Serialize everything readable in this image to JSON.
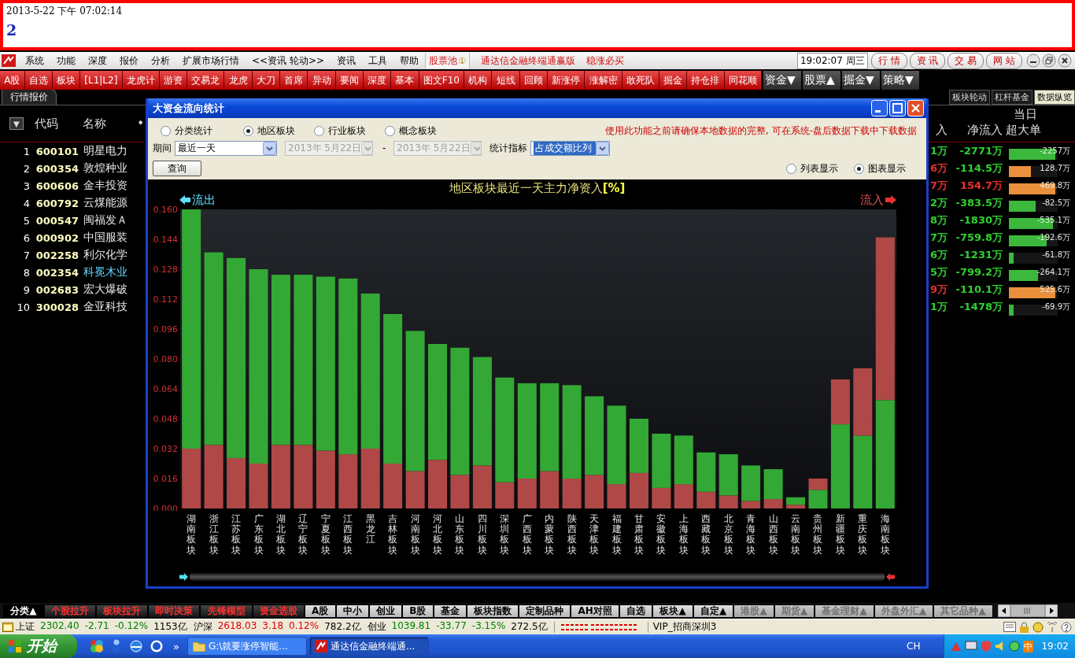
{
  "banner": {
    "datetime": "2013-5-22 下午 07:02:14",
    "counter": "2"
  },
  "menu_bar": {
    "items": [
      "系统",
      "功能",
      "深度",
      "报价",
      "分析",
      "扩展市场行情",
      "<<资讯 轮动>>",
      "资讯",
      "工具",
      "帮助"
    ],
    "stock_pool": {
      "label": "股票池",
      "badge": "①"
    },
    "slogans": [
      "通达信金融终端通赢版",
      "稳涨必买"
    ],
    "clock": "19:02:07 周三",
    "nav_buttons": [
      "行 情",
      "资 讯",
      "交 易",
      "网 站"
    ]
  },
  "toolbar": {
    "buttons": [
      "A股",
      "自选",
      "板块",
      "[L1|L2]",
      "龙虎计",
      "游资",
      "交易龙",
      "龙虎",
      "大刀",
      "首席",
      "异动",
      "要闻",
      "深度",
      "基本",
      "图文F10",
      "机构",
      "短线",
      "回顾",
      "新涨停",
      "涨解密",
      "敢死队",
      "掘金",
      "持仓排",
      "同花顺"
    ],
    "dropdowns": [
      "资金▼",
      "股票▲",
      "掘金▼",
      "策略▼"
    ]
  },
  "panel_tabs": [
    {
      "label": "行情报价",
      "selected": true
    }
  ],
  "side_tabs": [
    {
      "label": "板块轮动",
      "selected": false
    },
    {
      "label": "杠杆基金",
      "selected": false
    },
    {
      "label": "数据纵览",
      "selected": true
    }
  ],
  "stock_table": {
    "sort_button": "▼",
    "columns": [
      "代码",
      "名称",
      "•"
    ],
    "rows": [
      {
        "index": "1",
        "code": "600101",
        "name": "明星电力",
        "flagged": false
      },
      {
        "index": "2",
        "code": "600354",
        "name": "敦煌种业",
        "flagged": false
      },
      {
        "index": "3",
        "code": "600606",
        "name": "金丰投资",
        "flagged": false
      },
      {
        "index": "4",
        "code": "600792",
        "name": "云煤能源",
        "flagged": false
      },
      {
        "index": "5",
        "code": "000547",
        "name": "闽福发Ａ",
        "flagged": false
      },
      {
        "index": "6",
        "code": "000902",
        "name": "中国服装",
        "flagged": false
      },
      {
        "index": "7",
        "code": "002258",
        "name": "利尔化学",
        "flagged": false
      },
      {
        "index": "8",
        "code": "002354",
        "name": "科冕木业",
        "flagged": true
      },
      {
        "index": "9",
        "code": "002683",
        "name": "宏大爆破",
        "flagged": false
      },
      {
        "index": "10",
        "code": "300028",
        "name": "金亚科技",
        "flagged": false
      }
    ]
  },
  "flow_table": {
    "group_header": "当日",
    "columns": [
      "入",
      "净流入",
      "超大单"
    ],
    "rows": [
      {
        "column_1": "1万",
        "column_1_rising": false,
        "net_inflow": "-2771万",
        "net_rising": false,
        "super_large": {
          "text": "-2257万",
          "level": 0.95,
          "color": "#3cb83c"
        }
      },
      {
        "column_1": "6万",
        "column_1_rising": true,
        "net_inflow": "-114.5万",
        "net_rising": false,
        "super_large": {
          "text": "128.7万",
          "level": 0.45,
          "color": "#e8903c"
        }
      },
      {
        "column_1": "7万",
        "column_1_rising": true,
        "net_inflow": "154.7万",
        "net_rising": true,
        "super_large": {
          "text": "469.8万",
          "level": 0.95,
          "color": "#e8903c"
        }
      },
      {
        "column_1": "2万",
        "column_1_rising": false,
        "net_inflow": "-383.5万",
        "net_rising": false,
        "super_large": {
          "text": "-82.5万",
          "level": 0.55,
          "color": "#3cb83c"
        }
      },
      {
        "column_1": "8万",
        "column_1_rising": false,
        "net_inflow": "-1830万",
        "net_rising": false,
        "super_large": {
          "text": "-535.1万",
          "level": 0.9,
          "color": "#3cb83c"
        }
      },
      {
        "column_1": "7万",
        "column_1_rising": false,
        "net_inflow": "-759.8万",
        "net_rising": false,
        "super_large": {
          "text": "-192.6万",
          "level": 0.78,
          "color": "#3cb83c"
        }
      },
      {
        "column_1": "6万",
        "column_1_rising": false,
        "net_inflow": "-1231万",
        "net_rising": false,
        "super_large": {
          "text": "-61.8万",
          "level": 0.1,
          "color": "#3cb83c"
        }
      },
      {
        "column_1": "5万",
        "column_1_rising": false,
        "net_inflow": "-799.2万",
        "net_rising": false,
        "super_large": {
          "text": "-264.1万",
          "level": 0.6,
          "color": "#3cb83c"
        }
      },
      {
        "column_1": "9万",
        "column_1_rising": true,
        "net_inflow": "-110.1万",
        "net_rising": false,
        "super_large": {
          "text": "525.6万",
          "level": 0.95,
          "color": "#e8903c"
        }
      },
      {
        "column_1": "1万",
        "column_1_rising": false,
        "net_inflow": "-1478万",
        "net_rising": false,
        "super_large": {
          "text": "-69.9万",
          "level": 0.1,
          "color": "#3cb83c"
        }
      }
    ]
  },
  "dialog": {
    "title": "大资金流向统计",
    "scopes": [
      {
        "label": "分类统计",
        "selected": false
      },
      {
        "label": "地区板块",
        "selected": true
      },
      {
        "label": "行业板块",
        "selected": false
      },
      {
        "label": "概念板块",
        "selected": false
      }
    ],
    "notice": "使用此功能之前请确保本地数据的完整, 可在系统-盘后数据下载中下载数据",
    "period": {
      "label": "期间",
      "value": "最近一天"
    },
    "date_from": {
      "value": "2013年 5月22日",
      "disabled": true
    },
    "date_separator": "-",
    "date_to": {
      "value": "2013年 5月22日",
      "disabled": true
    },
    "metric": {
      "label": "统计指标",
      "value": "占成交额比列"
    },
    "query_button": "查询",
    "views": [
      {
        "label": "列表显示",
        "selected": false
      },
      {
        "label": "图表显示",
        "selected": true
      }
    ],
    "chart": {
      "chart_data": {
        "type": "bar",
        "title": "地区板块最近一天主力净资入**[%]**",
        "stacked": true,
        "categories": [
          "湖南板块",
          "浙江板块",
          "江苏板块",
          "广东板块",
          "湖北板块",
          "辽宁板块",
          "宁夏板块",
          "江西板块",
          "黑龙江",
          "吉林板块",
          "河南板块",
          "河北板块",
          "山东板块",
          "四川板块",
          "深圳板块",
          "广西板块",
          "内蒙板块",
          "陕西板块",
          "天津板块",
          "福建板块",
          "甘肃板块",
          "安徽板块",
          "上海板块",
          "西藏板块",
          "北京板块",
          "青海板块",
          "山西板块",
          "云南板块",
          "贵州板块",
          "新疆板块",
          "重庆板块",
          "海南板块"
        ],
        "series": [
          {
            "color": "#b04848",
            "values": [
              0.032,
              0.034,
              0.027,
              0.024,
              0.034,
              0.034,
              0.031,
              0.029,
              0.032,
              0.024,
              0.02,
              0.026,
              0.018,
              0.023,
              0.014,
              0.016,
              0.02,
              0.016,
              0.018,
              0.013,
              0.019,
              0.011,
              0.013,
              0.009,
              0.007,
              0.004,
              0.005,
              0.002,
              null,
              null,
              null,
              null
            ]
          },
          {
            "name": "流出",
            "color": "#34a834",
            "values": [
              0.128,
              0.103,
              0.107,
              0.104,
              0.091,
              0.091,
              0.093,
              0.094,
              0.083,
              0.08,
              0.075,
              0.062,
              0.068,
              0.058,
              0.056,
              0.051,
              0.047,
              0.05,
              0.042,
              0.042,
              0.029,
              0.029,
              0.026,
              0.021,
              0.022,
              0.019,
              0.016,
              0.004,
              0.01,
              0.045,
              0.039,
              0.058
            ]
          },
          {
            "name": "流入",
            "color": "#b04848",
            "values": [
              null,
              null,
              null,
              null,
              null,
              null,
              null,
              null,
              null,
              null,
              null,
              null,
              null,
              null,
              null,
              null,
              null,
              null,
              null,
              null,
              null,
              null,
              null,
              null,
              null,
              null,
              null,
              null,
              0.006,
              0.024,
              0.036,
              0.087
            ]
          }
        ],
        "ylim": [
          0,
          0.16
        ],
        "yticks": [
          {
            "value": 0,
            "label": "0.000"
          },
          {
            "value": 0.016,
            "label": "0.016"
          },
          {
            "value": 0.032,
            "label": "0.032"
          },
          {
            "value": 0.048,
            "label": "0.048"
          },
          {
            "value": 0.064,
            "label": "0.064"
          },
          {
            "value": 0.08,
            "label": "0.080"
          },
          {
            "value": 0.096,
            "label": "0.096"
          },
          {
            "value": 0.112,
            "label": "0.112"
          },
          {
            "value": 0.128,
            "label": "0.128"
          },
          {
            "value": 0.144,
            "label": "0.144"
          },
          {
            "value": 0.16,
            "label": "0.160"
          }
        ]
      }
    }
  },
  "category_tabs": [
    {
      "label": "分类▲",
      "kind": "menu",
      "selected": true
    },
    {
      "label": "个股拉升",
      "kind": "feature",
      "selected": false
    },
    {
      "label": "板块拉升",
      "kind": "feature",
      "selected": false
    },
    {
      "label": "即时决策",
      "kind": "feature",
      "selected": false
    },
    {
      "label": "先锋模型",
      "kind": "feature",
      "selected": false
    },
    {
      "label": "资金选股",
      "kind": "feature",
      "selected": false
    },
    {
      "label": "A股",
      "kind": "market",
      "selected": false
    },
    {
      "label": "中小",
      "kind": "market",
      "selected": false
    },
    {
      "label": "创业",
      "kind": "market",
      "selected": false
    },
    {
      "label": "B股",
      "kind": "market",
      "selected": false
    },
    {
      "label": "基金",
      "kind": "market",
      "selected": false
    },
    {
      "label": "板块指数",
      "kind": "market",
      "selected": false
    },
    {
      "label": "定制品种",
      "kind": "market",
      "selected": false
    },
    {
      "label": "AH对照",
      "kind": "market",
      "selected": false
    },
    {
      "label": "自选",
      "kind": "market",
      "selected": false
    },
    {
      "label": "板块▲",
      "kind": "market",
      "selected": false
    },
    {
      "label": "自定▲",
      "kind": "market",
      "selected": false
    },
    {
      "label": "港股▲",
      "kind": "dim",
      "selected": false
    },
    {
      "label": "期货▲",
      "kind": "dim",
      "selected": false
    },
    {
      "label": "基金理财▲",
      "kind": "dim",
      "selected": false
    },
    {
      "label": "外盘外汇▲",
      "kind": "dim",
      "selected": false
    },
    {
      "label": "其它品种▲",
      "kind": "dim",
      "selected": false
    }
  ],
  "status_bar": {
    "indices": [
      {
        "name": "上证",
        "price": "2302.40",
        "change": "-2.71",
        "percent": "-0.12%",
        "amount": "1153亿",
        "rising": false
      },
      {
        "name": "沪深",
        "price": "2618.03",
        "change": "3.18",
        "percent": "0.12%",
        "amount": "782.2亿",
        "rising": true
      },
      {
        "name": "创业",
        "price": "1039.81",
        "change": "-33.77",
        "percent": "-3.15%",
        "amount": "272.5亿",
        "rising": false
      }
    ],
    "server": "VIP_招商深圳3"
  },
  "taskbar": {
    "start": "开始",
    "overflow": "»",
    "tasks": [
      {
        "label": "G:\\就要涨停智能...",
        "selected": false
      },
      {
        "label": "通达信金融终端通...",
        "selected": true
      }
    ],
    "language": "CH",
    "ime": "中",
    "clock": "19:02"
  }
}
